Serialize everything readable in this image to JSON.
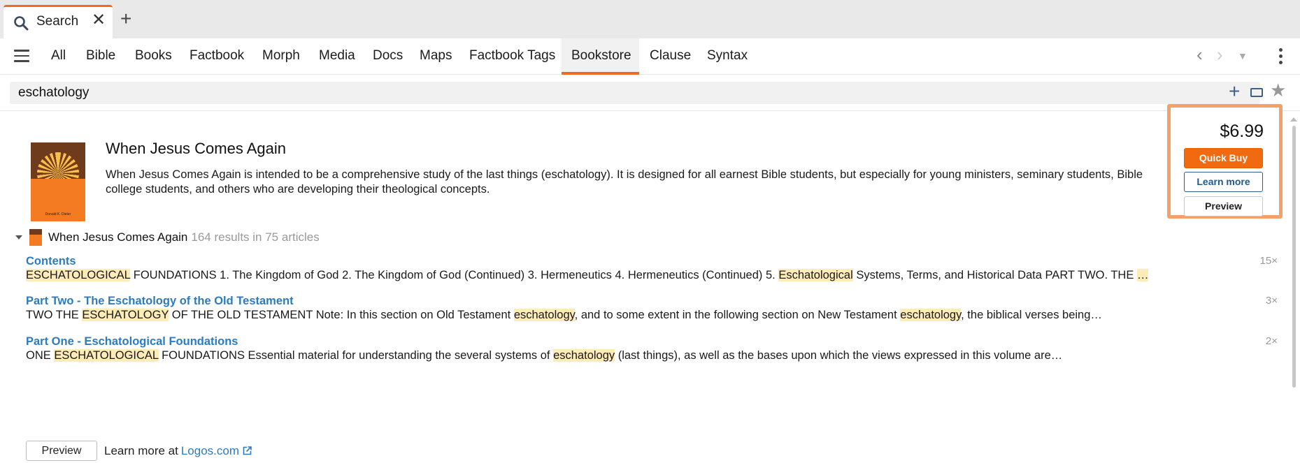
{
  "tab": {
    "label": "Search"
  },
  "nav": {
    "tabs": [
      "All",
      "Bible",
      "Books",
      "Factbook",
      "Morph",
      "Media",
      "Docs",
      "Maps",
      "Factbook Tags",
      "Bookstore",
      "Clause",
      "Syntax"
    ],
    "active": "Bookstore"
  },
  "search": {
    "value": "eschatology"
  },
  "book": {
    "title": "When Jesus Comes Again",
    "description": "When Jesus Comes Again is intended to be a comprehensive study of the last things (eschatology). It is designed for all earnest Bible students, but especially for young ministers, seminary students, Bible college students, and others who are developing their theological concepts.",
    "cover_author": "Donald K. Dieter"
  },
  "buy": {
    "price": "$6.99",
    "quick_buy": "Quick Buy",
    "learn_more": "Learn more",
    "preview": "Preview"
  },
  "results_header": {
    "title": "When Jesus Comes Again",
    "count": "164 results in 75 articles"
  },
  "results": [
    {
      "title": "Contents",
      "count": "15×",
      "parts": [
        {
          "t": "ESCHATOLOGICAL",
          "hl": true
        },
        {
          "t": " FOUNDATIONS 1. The Kingdom of God 2. The Kingdom of God (Continued) 3. Hermeneutics 4. Hermeneutics (Continued) 5. ",
          "hl": false
        },
        {
          "t": "Eschatological",
          "hl": true
        },
        {
          "t": " Systems, Terms, and Historical Data PART TWO. THE ",
          "hl": false
        },
        {
          "t": "…",
          "hl": true
        }
      ]
    },
    {
      "title": "Part Two - The Eschatology of the Old Testament",
      "count": "3×",
      "parts": [
        {
          "t": "TWO THE ",
          "hl": false
        },
        {
          "t": "ESCHATOLOGY",
          "hl": true
        },
        {
          "t": " OF THE OLD TESTAMENT Note: In this section on Old Testament ",
          "hl": false
        },
        {
          "t": "eschatology",
          "hl": true
        },
        {
          "t": ", and to some extent in the following section on New Testament ",
          "hl": false
        },
        {
          "t": "eschatology",
          "hl": true
        },
        {
          "t": ", the biblical verses being…",
          "hl": false
        }
      ]
    },
    {
      "title": "Part One - Eschatological Foundations",
      "count": "2×",
      "parts": [
        {
          "t": "ONE ",
          "hl": false
        },
        {
          "t": "ESCHATOLOGICAL",
          "hl": true
        },
        {
          "t": " FOUNDATIONS Essential material for understanding the several systems of ",
          "hl": false
        },
        {
          "t": "eschatology",
          "hl": true
        },
        {
          "t": " (last things), as well as the bases upon which the views expressed in this volume are…",
          "hl": false
        }
      ]
    }
  ],
  "footer": {
    "preview": "Preview",
    "learn_more_at": "Learn more at",
    "link": "Logos.com"
  },
  "colors": {
    "accent": "#f06b1f",
    "link": "#2d7bbf",
    "highlight": "#fdebb8"
  }
}
